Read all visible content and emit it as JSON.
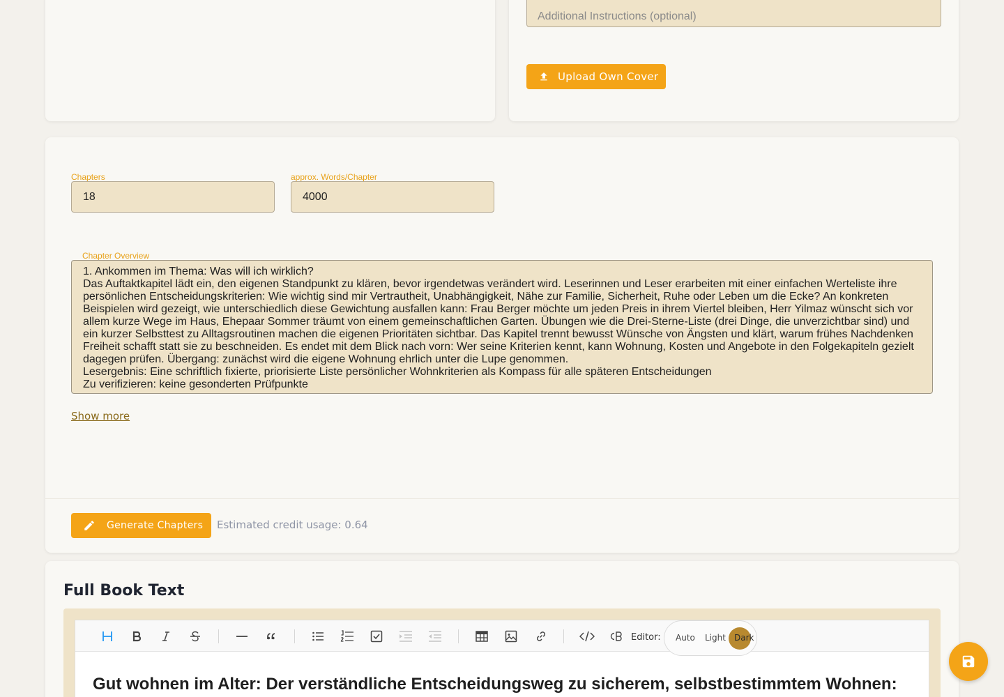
{
  "cover": {
    "instructions_placeholder": "Additional Instructions (optional)",
    "upload_label": "Upload Own Cover"
  },
  "settings": {
    "chapters_label": "Chapters",
    "chapters_value": "18",
    "words_label": "approx. Words/Chapter",
    "words_value": "4000"
  },
  "overview": {
    "label": "Chapter Overview",
    "lines": [
      "1. Ankommen im Thema: Was will ich wirklich?",
      "Das Auftaktkapitel lädt ein, den eigenen Standpunkt zu klären, bevor irgendetwas verändert wird. Leserinnen und Leser erarbeiten mit einer einfachen Werteliste ihre persönlichen Entscheidungskriterien: Wie wichtig sind mir Vertrautheit, Unabhängigkeit, Nähe zur Familie, Sicherheit, Ruhe oder Leben um die Ecke? An konkreten Beispielen wird gezeigt, wie unterschiedlich diese Gewichtung ausfallen kann: Frau Berger möchte um jeden Preis in ihrem Viertel bleiben, Herr Yilmaz wünscht sich vor allem kurze Wege im Haus, Ehepaar Sommer träumt von einem gemeinschaftlichen Garten. Übungen wie die Drei-Sterne-Liste (drei Dinge, die unverzichtbar sind) und ein kurzer Selbsttest zu Alltagsroutinen machen die eigenen Prioritäten sichtbar. Das Kapitel trennt bewusst Wünsche von Ängsten und klärt, warum frühes Nachdenken Freiheit schafft statt sie zu beschneiden. Es endet mit dem Blick nach vorn: Wer seine Kriterien kennt, kann Wohnung, Kosten und Angebote in den Folgekapiteln gezielt dagegen prüfen. Übergang: zunächst wird die eigene Wohnung ehrlich unter die Lupe genommen.",
      "Lesergebnis: Eine schriftlich fixierte, priorisierte Liste persönlicher Wohnkriterien als Kompass für alle späteren Entscheidungen",
      "Zu verifizieren: keine gesonderten Prüfpunkte"
    ],
    "show_more": "Show more"
  },
  "generate": {
    "button_label": "Generate Chapters",
    "credit_text": "Estimated credit usage: 0.64"
  },
  "fulltext": {
    "title": "Full Book Text",
    "editor_label": "Editor:",
    "theme_options": [
      "Auto",
      "Light",
      "Dark"
    ],
    "theme_selected": "Dark",
    "heading": "Gut wohnen im Alter: Der verständliche Entscheidungsweg zu sicherem, selbstbestimmtem Wohnen:"
  },
  "colors": {
    "accent": "#f4a417",
    "field_bg": "#efe3c8",
    "label": "#e8a21a",
    "toolbar_active": "#2196f3",
    "dark_toggle": "#b8892f"
  },
  "icons": [
    "upload-icon",
    "pencil-icon",
    "heading-icon",
    "bold-icon",
    "italic-icon",
    "strikethrough-icon",
    "horizontal-rule-icon",
    "quote-icon",
    "bullet-list-icon",
    "ordered-list-icon",
    "task-list-icon",
    "indent-icon",
    "outdent-icon",
    "table-icon",
    "image-icon",
    "link-icon",
    "code-icon",
    "code-block-icon",
    "save-icon"
  ]
}
